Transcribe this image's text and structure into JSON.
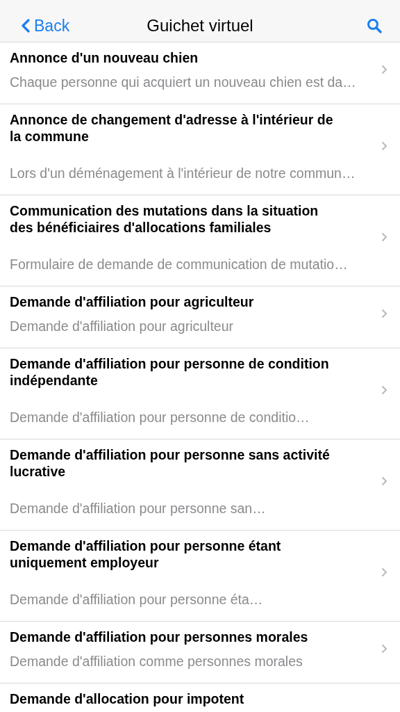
{
  "nav_bar": {
    "back": "Back",
    "title": "Guichet virtuel"
  },
  "items": [
    {
      "title": "Annonce d'un nouveau chien",
      "subtitle": "Chaque personne qui acquiert un nouveau chien est da…"
    },
    {
      "title": "Annonce de changement d'adresse à l'intérieur de la commune",
      "subtitle": "Lors d'un déménagement à l'intérieur de notre commun…"
    },
    {
      "title": "Communication des mutations dans la situation des bénéficiaires d'allocations familiales",
      "subtitle": "Formulaire de demande de communication de mutatio…"
    },
    {
      "title": "Demande d'affiliation pour agriculteur",
      "subtitle": "Demande d'affiliation pour agriculteur"
    },
    {
      "title": "Demande d'affiliation pour personne de condition indépendante",
      "subtitle": "Demande d'affiliation pour personne de conditio…"
    },
    {
      "title": "Demande d'affiliation pour personne sans activité lucrative",
      "subtitle": "Demande d'affiliation pour personne san…"
    },
    {
      "title": "Demande d'affiliation pour personne étant uniquement employeur",
      "subtitle": "Demande d'affiliation pour personne éta…"
    },
    {
      "title": "Demande d'affiliation pour personnes morales",
      "subtitle": "Demande d'affiliation comme personnes morales"
    },
    {
      "title": "Demande d'allocation pour impotent"
    }
  ]
}
